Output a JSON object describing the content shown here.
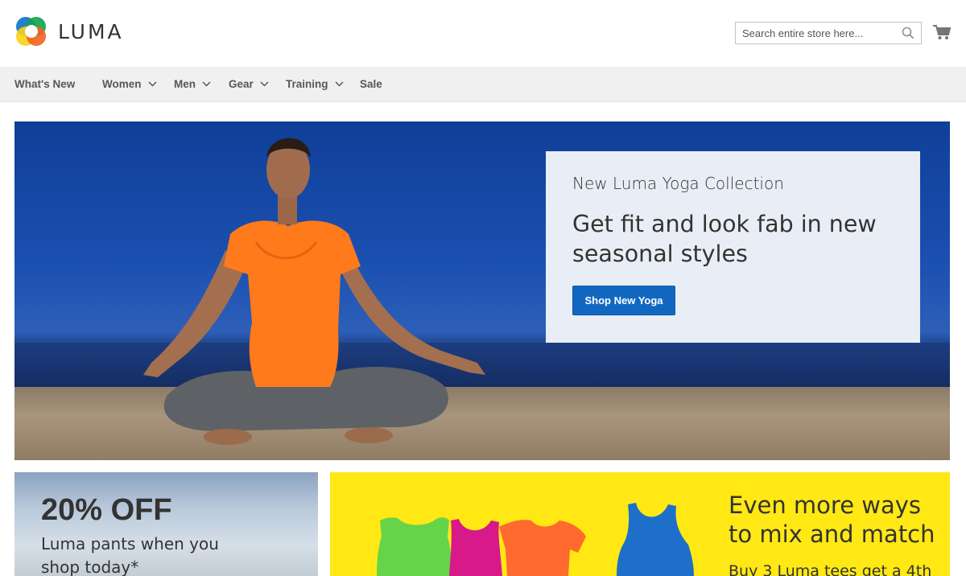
{
  "brand": {
    "name": "LUMA",
    "colors": {
      "blue": "#1979c3",
      "orange": "#f26322",
      "green": "#0fa24c",
      "yellow": "#fcd116"
    }
  },
  "search": {
    "placeholder": "Search entire store here...",
    "icon": "search-icon"
  },
  "cart": {
    "icon": "cart-icon"
  },
  "nav": {
    "items": [
      {
        "label": "What's New",
        "has_dropdown": false
      },
      {
        "label": "Women",
        "has_dropdown": true
      },
      {
        "label": "Men",
        "has_dropdown": true
      },
      {
        "label": "Gear",
        "has_dropdown": true
      },
      {
        "label": "Training",
        "has_dropdown": true
      },
      {
        "label": "Sale",
        "has_dropdown": false
      }
    ]
  },
  "hero": {
    "kicker": "New Luma Yoga Collection",
    "title": "Get fit and look fab in new seasonal styles",
    "button": "Shop New Yoga",
    "button_color": "#1979c3"
  },
  "promo_left": {
    "title": "20% OFF",
    "text": "Luma pants when you shop today*"
  },
  "promo_right": {
    "title": "Even more ways to mix and match",
    "text": "Buy 3 Luma tees get a 4th",
    "background": "#ffe814"
  }
}
